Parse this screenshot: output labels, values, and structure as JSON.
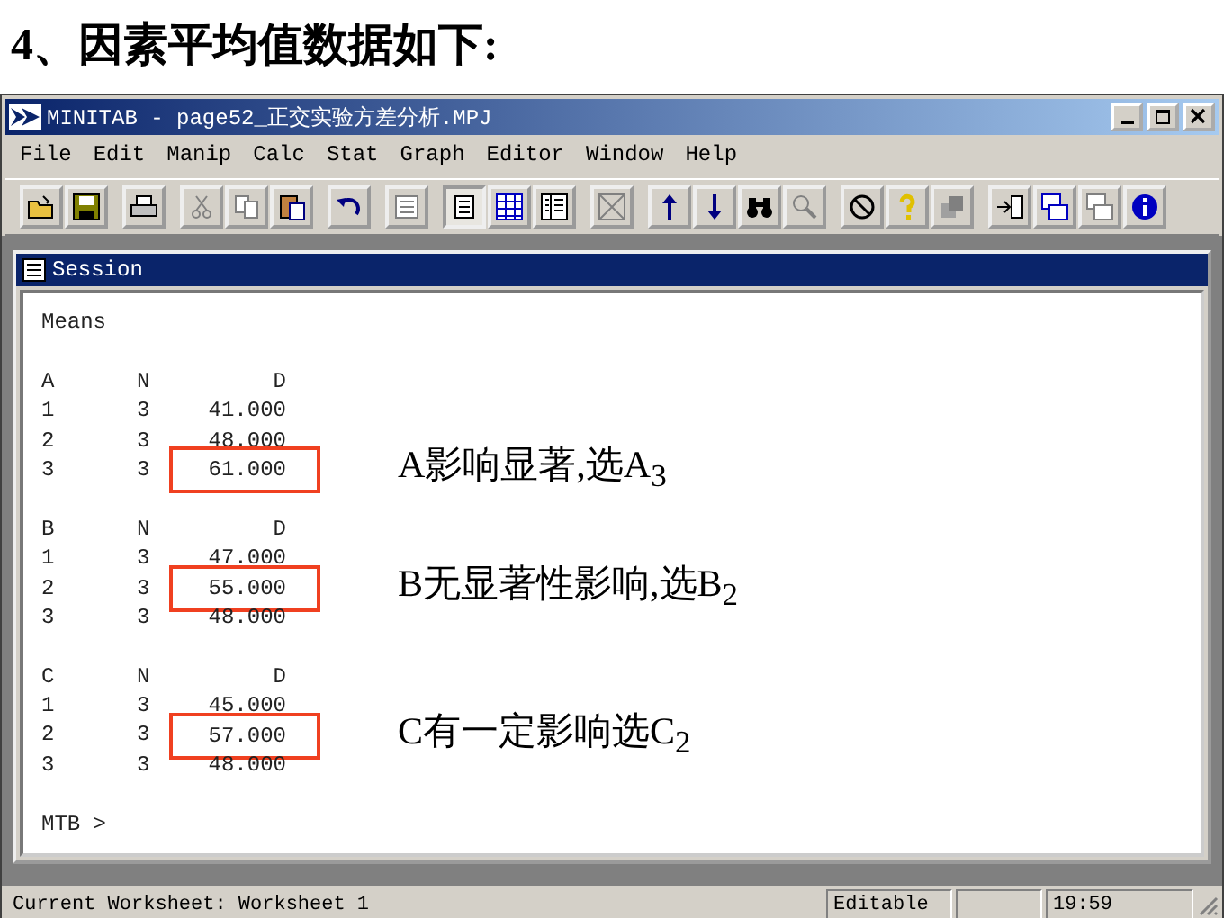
{
  "slide_title": "4、因素平均值数据如下:",
  "window": {
    "title": "MINITAB - page52_正交实验方差分析.MPJ"
  },
  "menu": [
    "File",
    "Edit",
    "Manip",
    "Calc",
    "Stat",
    "Graph",
    "Editor",
    "Window",
    "Help"
  ],
  "session": {
    "title": "Session",
    "heading": "Means",
    "prompt": "MTB >",
    "groups": [
      {
        "header": [
          "A",
          "N",
          "D"
        ],
        "note": "A影响显著,选A$_{3}$",
        "rows": [
          {
            "cells": [
              "1",
              "3",
              "41.000"
            ],
            "boxed": false
          },
          {
            "cells": [
              "2",
              "3",
              "48.000"
            ],
            "boxed": false
          },
          {
            "cells": [
              "3",
              "3",
              "61.000"
            ],
            "boxed": true
          }
        ]
      },
      {
        "header": [
          "B",
          "N",
          "D"
        ],
        "note": "B无显著性影响,选B$_{2}$",
        "rows": [
          {
            "cells": [
              "1",
              "3",
              "47.000"
            ],
            "boxed": false
          },
          {
            "cells": [
              "2",
              "3",
              "55.000"
            ],
            "boxed": true
          },
          {
            "cells": [
              "3",
              "3",
              "48.000"
            ],
            "boxed": false
          }
        ]
      },
      {
        "header": [
          "C",
          "N",
          "D"
        ],
        "note": "C有一定影响选C$_{2}$",
        "rows": [
          {
            "cells": [
              "1",
              "3",
              "45.000"
            ],
            "boxed": false
          },
          {
            "cells": [
              "2",
              "3",
              "57.000"
            ],
            "boxed": true
          },
          {
            "cells": [
              "3",
              "3",
              "48.000"
            ],
            "boxed": false
          }
        ]
      }
    ]
  },
  "status_bar": {
    "message": "Current Worksheet: Worksheet 1",
    "mode": "Editable",
    "time": "19:59"
  }
}
